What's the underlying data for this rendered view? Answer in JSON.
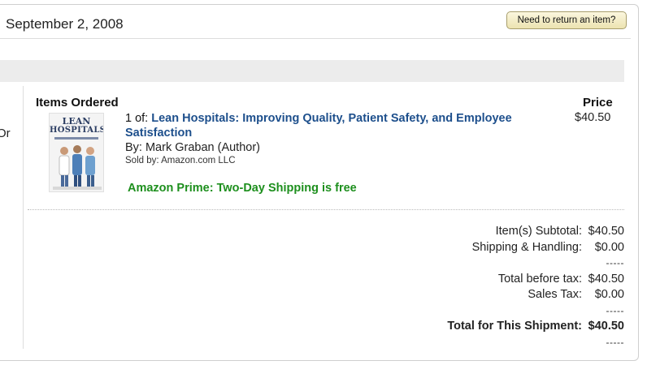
{
  "header": {
    "order_date": "September 2, 2008",
    "return_button": "Need to return an item?"
  },
  "left_fragment": "Or",
  "items": {
    "heading": "Items Ordered",
    "price_heading": "Price",
    "list": [
      {
        "quantity_prefix": "1 of:",
        "title": "Lean Hospitals: Improving Quality, Patient Safety, and Employee Satisfaction",
        "by": "By: Mark Graban (Author)",
        "sold_by": "Sold by: Amazon.com LLC",
        "shipping_note": "Amazon Prime: Two-Day Shipping is free",
        "price": "$40.50",
        "cover": {
          "title_line1": "LEAN",
          "title_line2": "HOSPITALS"
        }
      }
    ]
  },
  "totals": {
    "subtotal_label": "Item(s) Subtotal:",
    "subtotal_value": "$40.50",
    "shipping_label": "Shipping & Handling:",
    "shipping_value": "$0.00",
    "separator1": "-----",
    "before_tax_label": "Total before tax:",
    "before_tax_value": "$40.50",
    "tax_label": "Sales Tax:",
    "tax_value": "$0.00",
    "separator2": "-----",
    "total_label": "Total for This Shipment:",
    "total_value": "$40.50",
    "separator3": "-----"
  },
  "colors": {
    "link": "#1d4f8c",
    "prime_green": "#1d8f1d",
    "button_bg": "#ece3b0",
    "section_bar": "#ececec"
  }
}
